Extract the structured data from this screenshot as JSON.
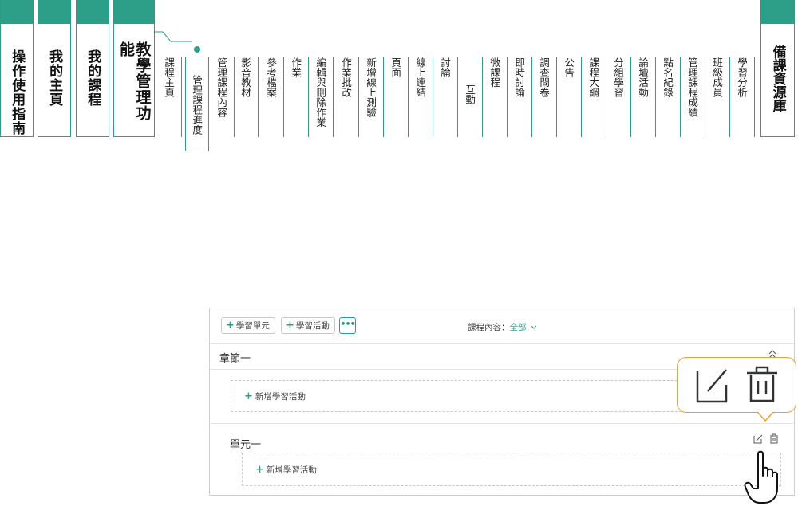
{
  "nav_tabs": [
    {
      "label": "操作使用指南"
    },
    {
      "label": "我的主頁"
    },
    {
      "label": "我的課程"
    },
    {
      "label": "教學管理功能"
    }
  ],
  "sub_menu": [
    {
      "label": "課程主頁"
    },
    {
      "label": "管理課程進度",
      "active": true
    },
    {
      "label": "管理課程內容"
    },
    {
      "label": "影音教材"
    },
    {
      "label": "參考檔案"
    },
    {
      "label": "作業"
    },
    {
      "label": "編輯與刪除作業"
    },
    {
      "label": "作業批改"
    },
    {
      "label": "新增線上測驗"
    },
    {
      "label": "頁面"
    },
    {
      "label": "線上連結"
    },
    {
      "label": "討論"
    },
    {
      "label": "互動"
    },
    {
      "label": "微課程"
    },
    {
      "label": "即時討論"
    },
    {
      "label": "調查問卷"
    },
    {
      "label": "公告"
    },
    {
      "label": "課程大綱"
    },
    {
      "label": "分組學習"
    },
    {
      "label": "論壇活動"
    },
    {
      "label": "點名紀錄"
    },
    {
      "label": "管理課程成績"
    },
    {
      "label": "班級成員"
    },
    {
      "label": "學習分析"
    }
  ],
  "right_tab": {
    "label": "備課資源庫"
  },
  "panel": {
    "toolbar": {
      "add_unit": "學習單元",
      "add_activity": "學習活動",
      "more": "•••",
      "filter_label": "課程內容：",
      "filter_value": "全部"
    },
    "chapter_title": "章節一",
    "add_activity_1": "新增學習活動",
    "unit_title": "單元一",
    "add_activity_2": "新增學習活動"
  },
  "colors": {
    "accent": "#2d9e88",
    "callout": "#f0a030"
  }
}
